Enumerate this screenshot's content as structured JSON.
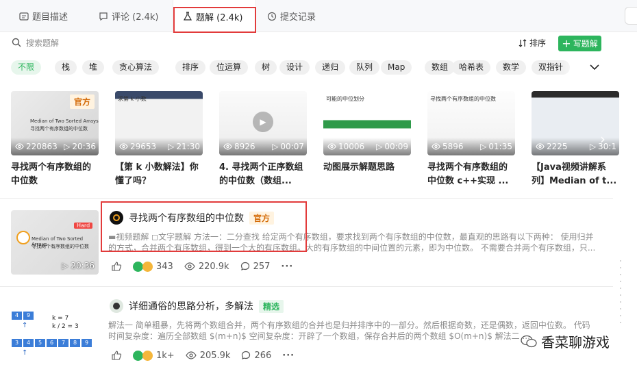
{
  "tabs": [
    {
      "label": "题目描述",
      "icon": "description-icon"
    },
    {
      "label": "评论 (2.4k)",
      "icon": "comment-icon"
    },
    {
      "label": "题解 (2.4k)",
      "icon": "flask-icon"
    },
    {
      "label": "提交记录",
      "icon": "history-icon"
    }
  ],
  "search": {
    "placeholder": "搜索题解",
    "sort_label": "排序",
    "write_label": "写题解"
  },
  "tags": [
    "不限",
    "栈",
    "堆",
    "贪心算法",
    "排序",
    "位运算",
    "树",
    "设计",
    "递归",
    "队列",
    "Map",
    "数组",
    "哈希表",
    "数学",
    "双指针"
  ],
  "videos": [
    {
      "views": "220863",
      "duration": "20:36",
      "title": "寻找两个有序数组的中位数",
      "badge": "官方",
      "thumb_en": "Median of Two Sorted Arrays",
      "thumb_cn": "寻找两个有序数组的中位数"
    },
    {
      "views": "29653",
      "duration": "21:30",
      "title": "【第 k 小数解法】你懂了吗？",
      "thumb_text": "求第 k 小数"
    },
    {
      "views": "8926",
      "duration": "00:07",
      "title": "4. 寻找两个正序数组的中位数（数组..."
    },
    {
      "views": "10006",
      "duration": "00:09",
      "title": "动图展示解题思路",
      "thumb_text": "可能的中位划分"
    },
    {
      "views": "5896",
      "duration": "01:35",
      "title": "寻找两个有序数组的中位数 c++实现 ...",
      "thumb_text": "寻找两个有序数组的中位数"
    },
    {
      "views": "2225",
      "duration": "30:1",
      "title": "【Java视频讲解系列】Median of t..."
    }
  ],
  "solutions": [
    {
      "title": "寻找两个有序数组的中位数",
      "badge": "官方",
      "summary": "▬视频题解 ◻文字题解 方法一：二分查找 给定两个有序数组，要求找到两个有序数组的中位数，最直观的思路有以下两种： 使用归并的方式，合并两个有序数组，得到一个大的有序数组。大的有序数组的中间位置的元素，即为中位数。 不需要合并两个有序数组，只...",
      "likes": "343",
      "views": "220.9k",
      "comments": "257",
      "duration": "20:36",
      "thumb_tag": "Hard",
      "thumb_en": "Median of Two Sorted Arrays",
      "thumb_cn": "寻找两个有序数组的中位数"
    },
    {
      "title": "详细通俗的思路分析，多解法",
      "badge": "精选",
      "summary": "解法一 简单粗暴，先将两个数组合并，两个有序数组的合并也是归并排序中的一部分。然后根据奇数，还是偶数，返回中位数。 代码时间复杂度：遍历全部数组 $(m+n)$ 空间复杂度：开辟了一个数组，保存合并后的两个数组 $O(m+n)$ 解法二 ...",
      "likes": "1k+",
      "views": "205.9k",
      "comments": "266",
      "thumb_top": [
        "4",
        "9"
      ],
      "thumb_k": [
        "k = 7",
        "k / 2 = 3"
      ],
      "thumb_bottom": [
        "3",
        "4",
        "5",
        "6",
        "7",
        "8",
        "9"
      ]
    }
  ],
  "watermark": "香菜聊游戏",
  "colors": {
    "accent_green": "#2db55d",
    "official_orange": "#d46b08",
    "highlight_red": "#e23b3b"
  }
}
